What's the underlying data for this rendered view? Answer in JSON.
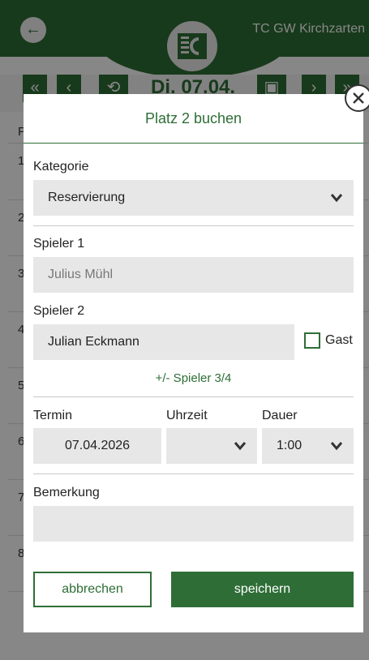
{
  "app": {
    "club_name": "TC GW Kirchzarten",
    "date_label": "Di. 07.04.",
    "nav": {
      "first_icon": "double-chevron-left-icon",
      "prev_icon": "chevron-left-icon",
      "history_icon": "history-icon",
      "person_icon": "person-badge-icon",
      "next_icon": "chevron-right-icon",
      "last_icon": "double-chevron-right-icon"
    },
    "table_header": "P",
    "row_numbers": [
      "1",
      "2",
      "3",
      "4",
      "5",
      "6",
      "7",
      "8"
    ],
    "colors": {
      "brand": "#2e6e36",
      "field_bg": "#e7e7e7"
    }
  },
  "modal": {
    "title": "Platz 2 buchen",
    "kategorie": {
      "label": "Kategorie",
      "value": "Reservierung"
    },
    "spieler1": {
      "label": "Spieler 1",
      "value": "Julius Mühl"
    },
    "spieler2": {
      "label": "Spieler 2",
      "value": "Julian Eckmann",
      "gast_label": "Gast",
      "gast_checked": false
    },
    "more_players": "+/- Spieler 3/4",
    "termin": {
      "label": "Termin",
      "value": "07.04.2026"
    },
    "uhrzeit": {
      "label": "Uhrzeit",
      "value": ""
    },
    "dauer": {
      "label": "Dauer",
      "value": "1:00"
    },
    "bemerkung": {
      "label": "Bemerkung",
      "value": ""
    },
    "cancel_label": "abbrechen",
    "save_label": "speichern"
  }
}
